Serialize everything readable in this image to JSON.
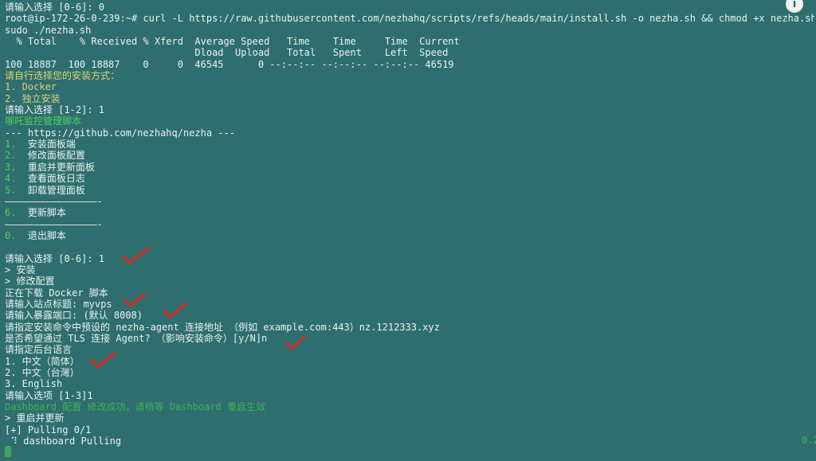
{
  "terminal": {
    "lines": [
      {
        "text": "请输入选择 [0-6]: 0",
        "style": "white"
      },
      {
        "text": "root@ip-172-26-0-239:~# curl -L https://raw.githubusercontent.com/nezhahq/scripts/refs/heads/main/install.sh -o nezha.sh && chmod +x nezha.sh &",
        "style": "white"
      },
      {
        "text": "sudo ./nezha.sh",
        "style": "white"
      },
      {
        "text": "  % Total    % Received % Xferd  Average Speed   Time    Time     Time  Current",
        "style": "white"
      },
      {
        "text": "                                 Dload  Upload   Total   Spent    Left  Speed",
        "style": "white"
      },
      {
        "text": "100 18887  100 18887    0     0  46545      0 --:--:-- --:--:-- --:--:-- 46519",
        "style": "white"
      },
      {
        "text": "请自行选择您的安装方式：",
        "style": "yellow"
      },
      {
        "text": "1. Docker",
        "style": "yellow"
      },
      {
        "text": "2. 独立安装",
        "style": "yellow"
      },
      {
        "text": "请输入选择 [1-2]: 1",
        "style": "white"
      },
      {
        "text": "哪吒监控管理脚本",
        "style": "green"
      },
      {
        "text": "--- https://github.com/nezhahq/nezha ---",
        "style": "white"
      },
      {
        "text": "1.  安装面板端",
        "style": "menu"
      },
      {
        "text": "2.  修改面板配置",
        "style": "menu"
      },
      {
        "text": "3.  重启并更新面板",
        "style": "menu"
      },
      {
        "text": "4.  查看面板日志",
        "style": "menu"
      },
      {
        "text": "5.  卸载管理面板",
        "style": "menu"
      },
      {
        "text": "————————————————-",
        "style": "rule"
      },
      {
        "text": "6.  更新脚本",
        "style": "menu"
      },
      {
        "text": "————————————————-",
        "style": "rule"
      },
      {
        "text": "0.  退出脚本",
        "style": "menu"
      },
      {
        "text": "",
        "style": "white"
      },
      {
        "text": "请输入选择 [0-6]: 1",
        "style": "white"
      },
      {
        "text": "> 安装",
        "style": "white"
      },
      {
        "text": "> 修改配置",
        "style": "white"
      },
      {
        "text": "正在下载 Docker 脚本",
        "style": "white"
      },
      {
        "text": "请输入站点标题: myvps",
        "style": "white"
      },
      {
        "text": "请输入暴露端口: (默认 8008)",
        "style": "white"
      },
      {
        "text": "请指定安装命令中预设的 nezha-agent 连接地址 （例如 example.com:443）nz.1212333.xyz",
        "style": "white"
      },
      {
        "text": "是否希望通过 TLS 连接 Agent? （影响安装命令）[y/N]n",
        "style": "white"
      },
      {
        "text": "请指定后台语言",
        "style": "white"
      },
      {
        "text": "1. 中文（简体）",
        "style": "white"
      },
      {
        "text": "2. 中文（台灣）",
        "style": "white"
      },
      {
        "text": "3. English",
        "style": "white"
      },
      {
        "text": "请输入选项 [1-3]1",
        "style": "white"
      },
      {
        "text": "Dashboard 配置 修改成功，请稍等 Dashboard 重启生效",
        "style": "faint-green"
      },
      {
        "text": "> 重启并更新",
        "style": "white"
      },
      {
        "text": "[+] Pulling 0/1",
        "style": "white"
      },
      {
        "text": " ⠹ dashboard Pulling",
        "style": "white"
      }
    ],
    "corner_fragment": "0.2",
    "info_icon": "i"
  },
  "annotations": {
    "color": "#e0281f",
    "icon": "red-checkmark"
  }
}
